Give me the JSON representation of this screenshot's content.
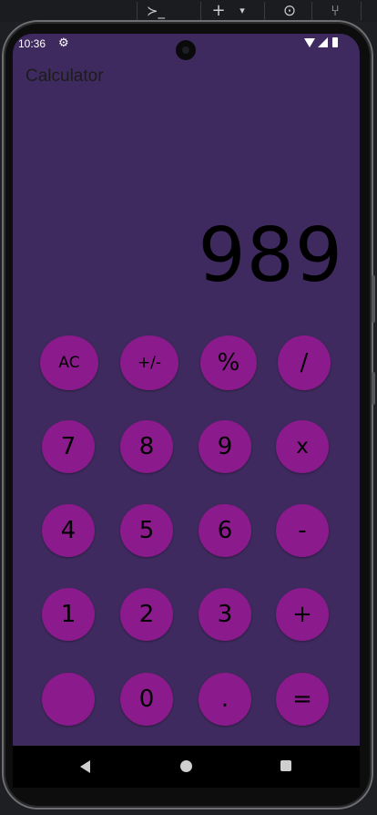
{
  "toolbar": {
    "terminal_glyph": "≻_",
    "add_glyph": "+",
    "dropdown_glyph": "▾",
    "record_glyph": "⊙",
    "vcs_glyph": "⑂"
  },
  "status_bar": {
    "time": "10:36",
    "settings_icon": "⚙"
  },
  "app": {
    "title": "Calculator",
    "display_value": "989"
  },
  "keys": [
    {
      "label": "AC",
      "name": "all-clear-button"
    },
    {
      "label": "+/-",
      "name": "sign-toggle-button"
    },
    {
      "label": "%",
      "name": "percent-button"
    },
    {
      "label": "/",
      "name": "divide-button"
    },
    {
      "label": "7",
      "name": "digit-7-button"
    },
    {
      "label": "8",
      "name": "digit-8-button"
    },
    {
      "label": "9",
      "name": "digit-9-button"
    },
    {
      "label": "x",
      "name": "multiply-button"
    },
    {
      "label": "4",
      "name": "digit-4-button"
    },
    {
      "label": "5",
      "name": "digit-5-button"
    },
    {
      "label": "6",
      "name": "digit-6-button"
    },
    {
      "label": "-",
      "name": "subtract-button"
    },
    {
      "label": "1",
      "name": "digit-1-button"
    },
    {
      "label": "2",
      "name": "digit-2-button"
    },
    {
      "label": "3",
      "name": "digit-3-button"
    },
    {
      "label": "+",
      "name": "add-button"
    },
    {
      "label": "",
      "name": "blank-button"
    },
    {
      "label": "0",
      "name": "digit-0-button"
    },
    {
      "label": ".",
      "name": "decimal-button"
    },
    {
      "label": "=",
      "name": "equals-button"
    }
  ],
  "colors": {
    "screen_background": "#3e2a5e",
    "key_background": "#8b1a8c",
    "display_text": "#000000",
    "title_text": "#1c1c1c"
  },
  "icons": {
    "nav_back": "back-triangle-icon",
    "nav_home": "home-circle-icon",
    "nav_recents": "recents-square-icon"
  }
}
